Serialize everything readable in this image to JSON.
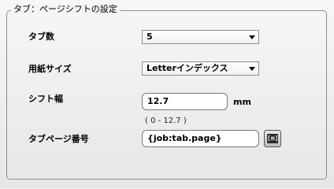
{
  "group": {
    "title": "タブ：ページシフトの設定"
  },
  "tab_count": {
    "label": "タブ数",
    "value": "5"
  },
  "paper_size": {
    "label": "用紙サイズ",
    "value": "Letterインデックス"
  },
  "shift_width": {
    "label": "シフト幅",
    "value": "12.7",
    "unit": "mm",
    "range": "( 0 - 12.7 )"
  },
  "tab_page_number": {
    "label": "タブページ番号",
    "value": "{job:tab.page}",
    "insert_button_icon": "[m]"
  },
  "icons": {
    "dropdown": "chevron-down-icon",
    "insert": "insert-variable-icon"
  }
}
